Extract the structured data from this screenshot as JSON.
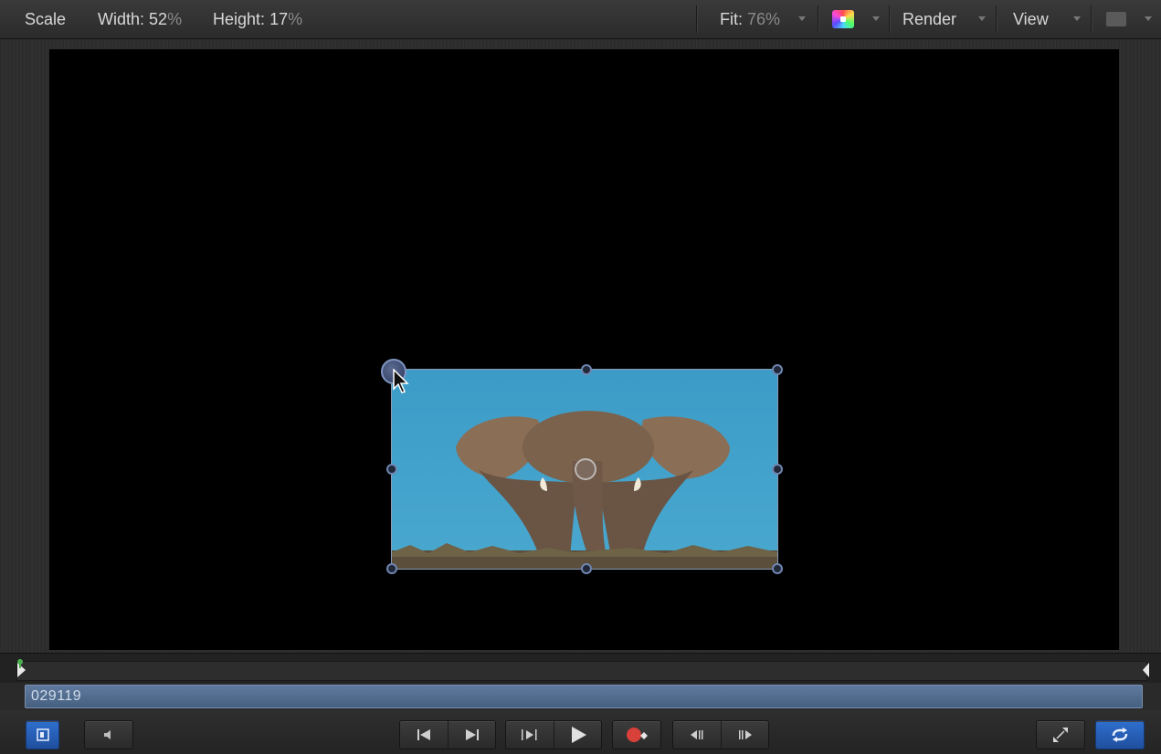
{
  "toolbar": {
    "tool_name": "Scale",
    "width_label": "Width:",
    "width_value": "52",
    "width_unit": "%",
    "height_label": "Height:",
    "height_value": "17",
    "height_unit": "%",
    "fit_label": "Fit:",
    "fit_value": "76%",
    "render_label": "Render",
    "view_label": "View"
  },
  "timecode": {
    "value": "029119"
  },
  "colors": {
    "accent": "#2f6fcf",
    "timecode_bg": "#5f7a9e",
    "canvas": "#000000"
  },
  "icons": {
    "layers_toggle": "show-layers-icon",
    "audio": "speaker-icon",
    "go_to_start": "go-to-start-icon",
    "go_to_end": "go-to-end-icon",
    "play_in_out": "play-range-icon",
    "play": "play-icon",
    "record": "record-icon",
    "prev_frame": "previous-frame-icon",
    "next_frame": "next-frame-icon",
    "fullscreen": "expand-icon",
    "loop": "loop-icon"
  }
}
